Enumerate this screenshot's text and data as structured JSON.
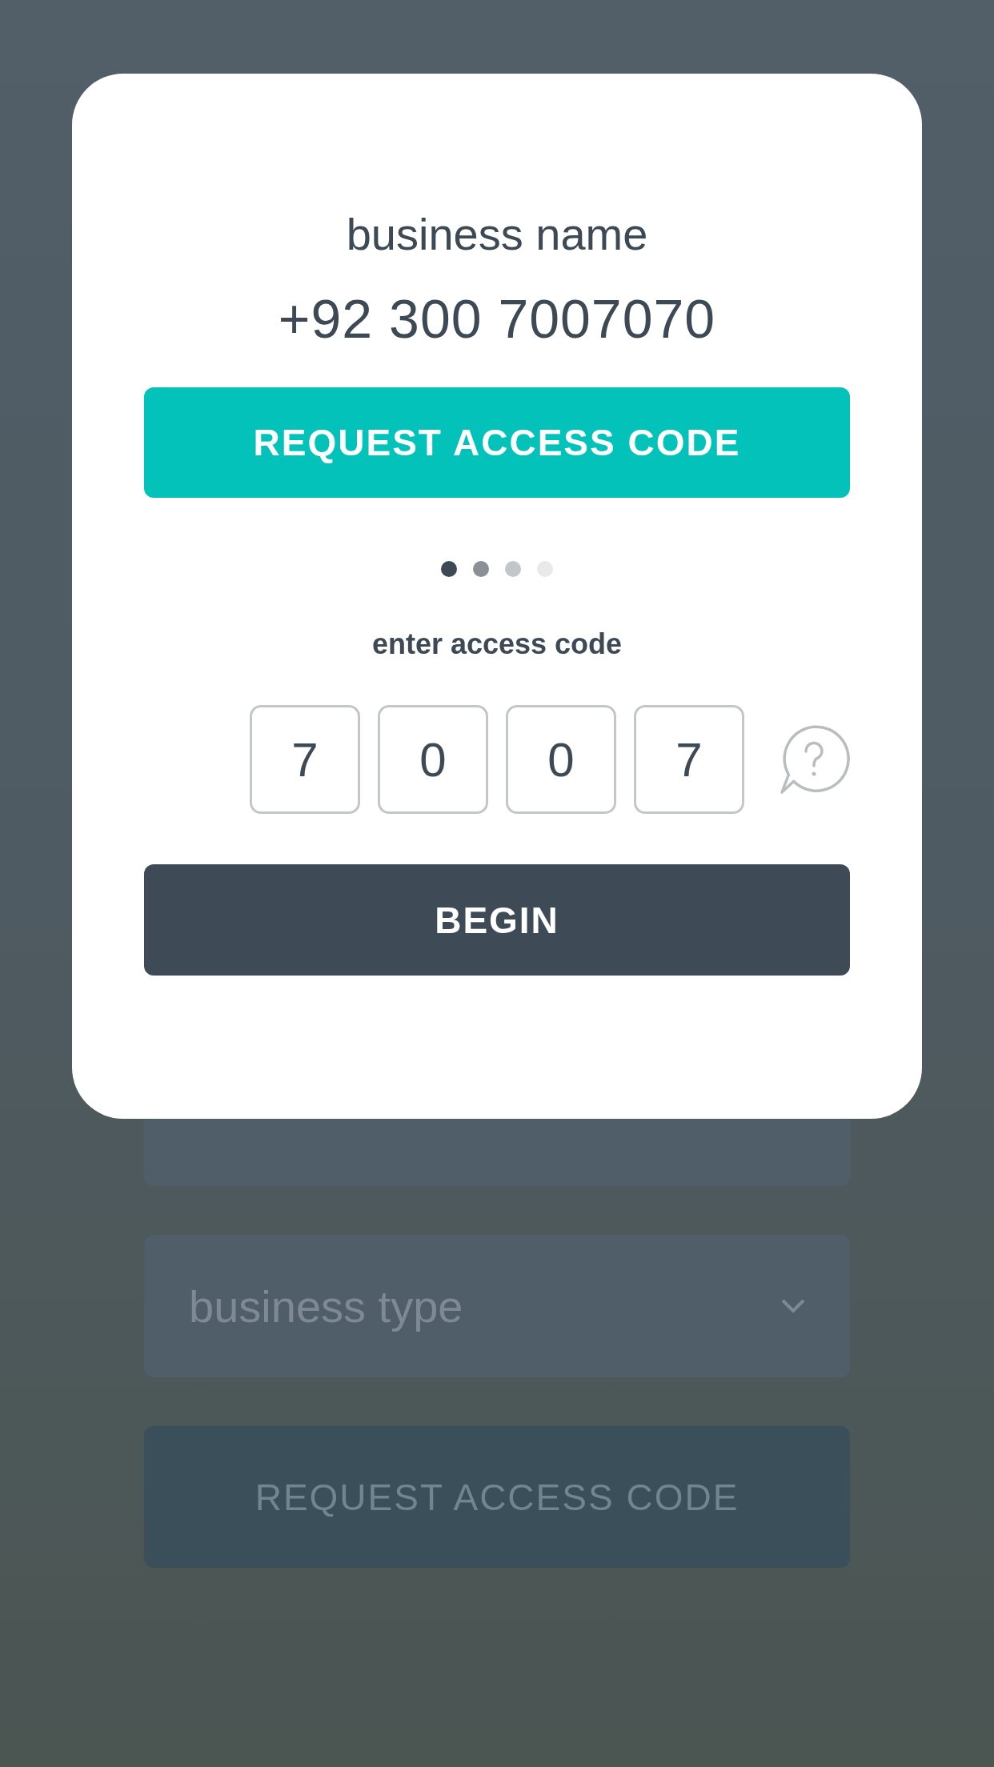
{
  "dialog": {
    "business_name": "business name",
    "phone": "+92 300 7007070",
    "request_button": "REQUEST ACCESS CODE",
    "pager_dots": [
      {
        "color": "#3d4a55"
      },
      {
        "color": "#8a9096"
      },
      {
        "color": "#c3c6c9"
      },
      {
        "color": "#e8e9ea"
      }
    ],
    "code_label": "enter access code",
    "code_digits": [
      "7",
      "0",
      "0",
      "7"
    ],
    "begin_button": "BEGIN"
  },
  "form": {
    "fields": [
      {
        "kind": "text"
      },
      {
        "kind": "select",
        "placeholder": "business type"
      }
    ],
    "submit_button": "REQUEST ACCESS CODE"
  }
}
